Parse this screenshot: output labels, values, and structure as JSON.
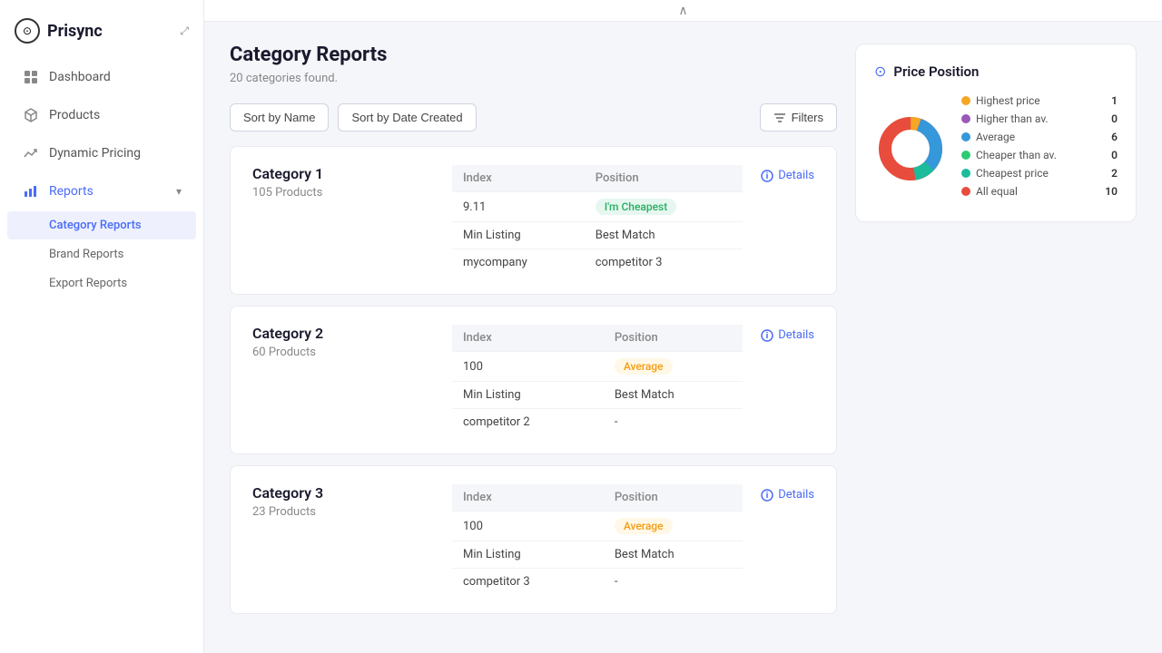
{
  "app": {
    "name": "Prisync"
  },
  "sidebar": {
    "nav_items": [
      {
        "id": "dashboard",
        "label": "Dashboard",
        "icon": "grid"
      },
      {
        "id": "products",
        "label": "Products",
        "icon": "box"
      },
      {
        "id": "dynamic-pricing",
        "label": "Dynamic Pricing",
        "icon": "trending-up"
      },
      {
        "id": "reports",
        "label": "Reports",
        "icon": "bar-chart",
        "expanded": true
      }
    ],
    "sub_nav": [
      {
        "id": "category-reports",
        "label": "Category Reports",
        "active": true
      },
      {
        "id": "brand-reports",
        "label": "Brand Reports"
      },
      {
        "id": "export-reports",
        "label": "Export Reports"
      }
    ]
  },
  "page": {
    "title": "Category Reports",
    "subtitle": "20 categories found."
  },
  "toolbar": {
    "sort_by_name": "Sort by Name",
    "sort_by_date": "Sort by Date Created",
    "filters": "Filters"
  },
  "categories": [
    {
      "name": "Category 1",
      "products": "105 Products",
      "details_label": "Details",
      "index": "9.11",
      "position": "I'm Cheapest",
      "position_type": "cheapest",
      "min_listing": "mycompany",
      "best_match": "competitor 3"
    },
    {
      "name": "Category 2",
      "products": "60 Products",
      "details_label": "Details",
      "index": "100",
      "position": "Average",
      "position_type": "average",
      "min_listing": "competitor 2",
      "best_match": "-"
    },
    {
      "name": "Category 3",
      "products": "23 Products",
      "details_label": "Details",
      "index": "100",
      "position": "Average",
      "position_type": "average",
      "min_listing": "competitor 3",
      "best_match": "-"
    }
  ],
  "table_headers": {
    "index": "Index",
    "position": "Position",
    "min_listing": "Min Listing",
    "best_match": "Best Match"
  },
  "price_position": {
    "title": "Price Position",
    "legend": [
      {
        "id": "highest",
        "label": "Highest price",
        "count": "1",
        "color": "#f5a623"
      },
      {
        "id": "higher",
        "label": "Higher than av.",
        "count": "0",
        "color": "#9b59b6"
      },
      {
        "id": "average",
        "label": "Average",
        "count": "6",
        "color": "#3498db"
      },
      {
        "id": "cheaper",
        "label": "Cheaper than av.",
        "count": "0",
        "color": "#2ecc71"
      },
      {
        "id": "cheapest",
        "label": "Cheapest price",
        "count": "2",
        "color": "#1abc9c"
      },
      {
        "id": "equal",
        "label": "All equal",
        "count": "10",
        "color": "#e74c3c"
      }
    ],
    "donut": {
      "segments": [
        {
          "label": "highest",
          "value": 1,
          "color": "#f5a623"
        },
        {
          "label": "higher",
          "value": 0,
          "color": "#9b59b6"
        },
        {
          "label": "average",
          "value": 6,
          "color": "#3498db"
        },
        {
          "label": "cheaper",
          "value": 0,
          "color": "#2ecc71"
        },
        {
          "label": "cheapest",
          "value": 2,
          "color": "#1abc9c"
        },
        {
          "label": "equal",
          "value": 10,
          "color": "#e74c3c"
        }
      ]
    }
  }
}
